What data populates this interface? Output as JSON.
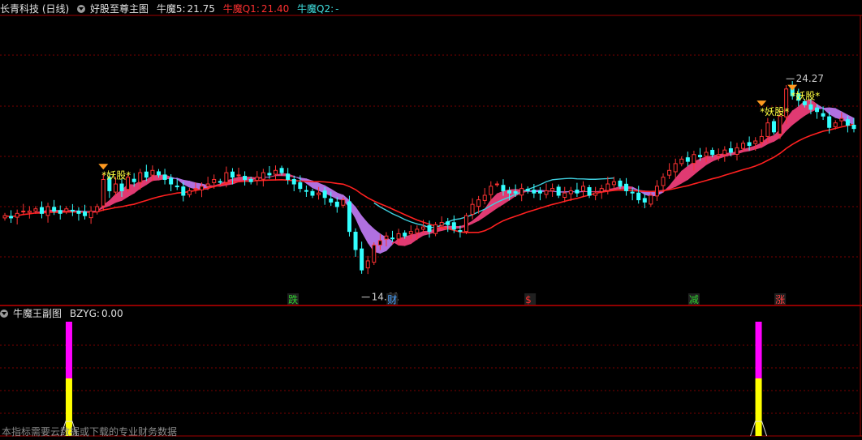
{
  "main_header": {
    "stock": "长青科技 (日线)",
    "indicator": "好股至尊主图",
    "m5_label": "牛魔5:",
    "m5_value": "21.75",
    "q1_label": "牛魔Q1:",
    "q1_value": "21.40",
    "q2_label": "牛魔Q2:",
    "q2_value": "-"
  },
  "sub_header": {
    "indicator": "牛魔王副图",
    "bzyg_label": "BZYG:",
    "bzyg_value": "0.00"
  },
  "footer_note": "本指标需要云数据或下载的专业财务数据",
  "colors": {
    "up": "#ff3333",
    "down": "#33ffff",
    "ma_slow": "#ff2020",
    "ma_fast": "#e03a72",
    "ribbon_down": "#b070e0",
    "q2": "#40d0e0",
    "sub_top": "#ff00ff",
    "sub_bottom": "#ffff00",
    "grid": "#7a0000"
  },
  "chart_data": [
    {
      "type": "candlestick",
      "title": "好股至尊主图",
      "ylim": [
        14.0,
        26.0
      ],
      "high_label": "24.27",
      "low_label": "14.61",
      "annotations": [
        "*妖股*",
        "*妖股*",
        "*妖股*"
      ],
      "event_markers": [
        {
          "text": "跌",
          "color": "#30d030"
        },
        {
          "text": "财",
          "color": "#4aa3ff"
        },
        {
          "text": "$",
          "color": "#ff3030"
        },
        {
          "text": "减",
          "color": "#30d030"
        },
        {
          "text": "涨",
          "color": "#ff4040"
        }
      ],
      "candle_closes": [
        17.9,
        17.8,
        18.0,
        18.1,
        18.1,
        18.2,
        18.0,
        18.3,
        18.1,
        18.0,
        18.2,
        18.1,
        18.0,
        17.9,
        18.1,
        18.3,
        19.5,
        19.0,
        19.3,
        19.0,
        19.6,
        19.4,
        19.8,
        19.6,
        19.9,
        19.7,
        19.5,
        19.3,
        19.2,
        18.8,
        19.0,
        19.1,
        19.2,
        19.3,
        19.5,
        19.4,
        19.8,
        19.6,
        19.7,
        19.5,
        19.4,
        19.6,
        19.8,
        19.7,
        19.9,
        19.8,
        19.5,
        19.3,
        19.1,
        19.0,
        18.8,
        18.9,
        18.7,
        18.5,
        18.3,
        18.6,
        17.2,
        16.4,
        15.5,
        15.9,
        16.6,
        16.8,
        17.0,
        16.9,
        17.1,
        17.0,
        17.2,
        17.3,
        17.4,
        17.2,
        17.5,
        17.6,
        17.5,
        17.3,
        17.2,
        17.9,
        18.4,
        18.6,
        18.8,
        19.2,
        19.3,
        19.0,
        18.9,
        18.9,
        19.1,
        19.0,
        18.9,
        18.9,
        19.0,
        19.1,
        18.8,
        18.9,
        19.0,
        18.9,
        19.2,
        18.8,
        18.9,
        19.1,
        19.3,
        19.4,
        19.2,
        19.0,
        18.9,
        18.6,
        18.5,
        18.8,
        19.2,
        19.6,
        19.9,
        20.2,
        20.4,
        20.3,
        20.6,
        20.5,
        20.7,
        20.6,
        20.6,
        20.8,
        20.7,
        20.9,
        21.1,
        21.0,
        21.2,
        21.4,
        22.0,
        21.6,
        22.3,
        23.5,
        23.2,
        23.0,
        22.8,
        22.6,
        22.5,
        22.3,
        21.8,
        22.0,
        22.2,
        21.9,
        21.75
      ],
      "series": [
        {
          "name": "牛魔5",
          "value": 21.75
        },
        {
          "name": "牛魔Q1",
          "value": 21.4
        },
        {
          "name": "牛魔Q2",
          "value": null
        }
      ]
    },
    {
      "type": "bar",
      "title": "牛魔王副图",
      "series": [
        {
          "name": "BZYG",
          "value": 0.0
        }
      ],
      "signals": [
        {
          "position": 0.08,
          "level": 1.0
        },
        {
          "position": 0.88,
          "level": 1.0
        }
      ]
    }
  ]
}
